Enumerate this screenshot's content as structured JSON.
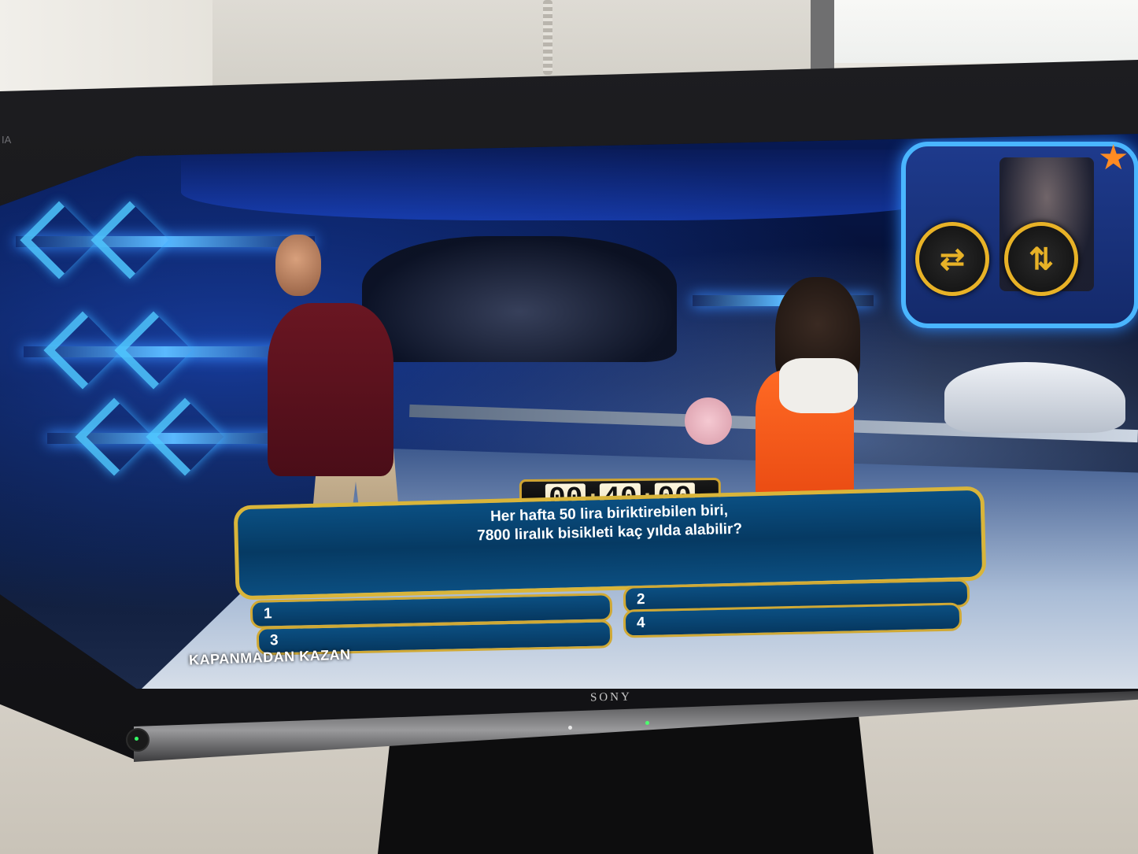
{
  "tv": {
    "brand": "SONY",
    "model_fragment": "IA"
  },
  "show": {
    "caption": "KAPANMADAN KAZAN",
    "timer": {
      "h": "00",
      "m": "40",
      "s": "00"
    },
    "question": {
      "line1": "Her hafta 50 lira biriktirebilen biri,",
      "line2": "7800 liralık bisikleti kaç yılda alabilir?"
    },
    "answers": [
      {
        "label": "1"
      },
      {
        "label": "2"
      },
      {
        "label": "3"
      },
      {
        "label": "4"
      }
    ],
    "lifelines": [
      {
        "icon": "swap-arrows-icon",
        "glyph": "⇄"
      },
      {
        "icon": "switch-people-icon",
        "glyph": "⇅"
      }
    ],
    "colors": {
      "accent_gold": "#d9b53a",
      "panel_blue": "#0a4f82",
      "neon_blue": "#4ab6ff"
    }
  }
}
